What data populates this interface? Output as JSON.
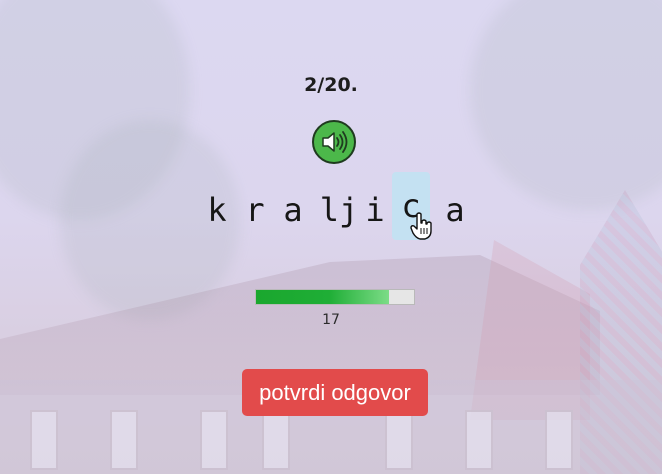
{
  "quiz": {
    "counter": "2/20.",
    "letters": [
      "k",
      "r",
      "a",
      "lj",
      "i",
      "c",
      "a"
    ],
    "selected_letter": "c",
    "timer": {
      "remaining_label": "17",
      "progress_fraction": 0.84
    },
    "confirm_label": "potvrdi odgovor"
  },
  "icons": {
    "audio": "speaker-icon",
    "pointer": "hand-cursor-icon"
  },
  "colors": {
    "speaker_button": "#4cb84a",
    "confirm_button": "#e24b4b",
    "progress_fill": "#1aa72e",
    "selected_highlight": "#c4e1f2"
  }
}
